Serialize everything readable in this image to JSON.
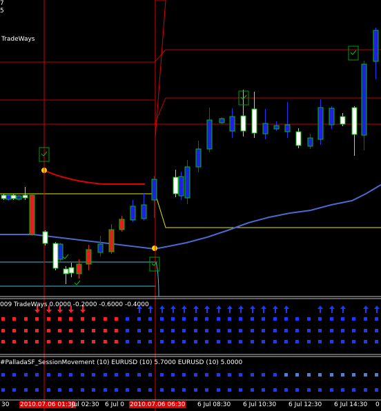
{
  "corner_labels": [
    "7",
    "5"
  ],
  "main_label": "TradeWays",
  "indicator1_label": "009 TradeWays 0.0000 -0.2000 -0.6000 -0.4000",
  "indicator2_label": "#PalladaSF_SessionMovement (10) EURUSD (10) 5.7000  EURUSD (10) 5.0000",
  "time_axis": {
    "labels": [
      "30",
      "Jul 02:30",
      "6 Jul 0",
      "6 Jul 08:30",
      "6 Jul 10:30",
      "6 Jul 12:30",
      "6 Jul 14:30",
      "0"
    ],
    "highlighted": [
      "2010.07.06 01:30",
      "2010.07.06 06:30"
    ]
  },
  "colors": {
    "background": "#000000",
    "bull_candle": "#2020e0",
    "bear_candle": "#ffffff",
    "bull_candle_border": "#00c000",
    "bear_candle_red": "#e02020",
    "vertical_marker": "#e00000",
    "session_line": "#c00000",
    "yellow_level": "#ffff00",
    "cyan_level": "#40c0e0",
    "moving_average": "#4a6ad0",
    "arrow_up": "#1a3aff",
    "arrow_down": "#ff2020"
  }
}
